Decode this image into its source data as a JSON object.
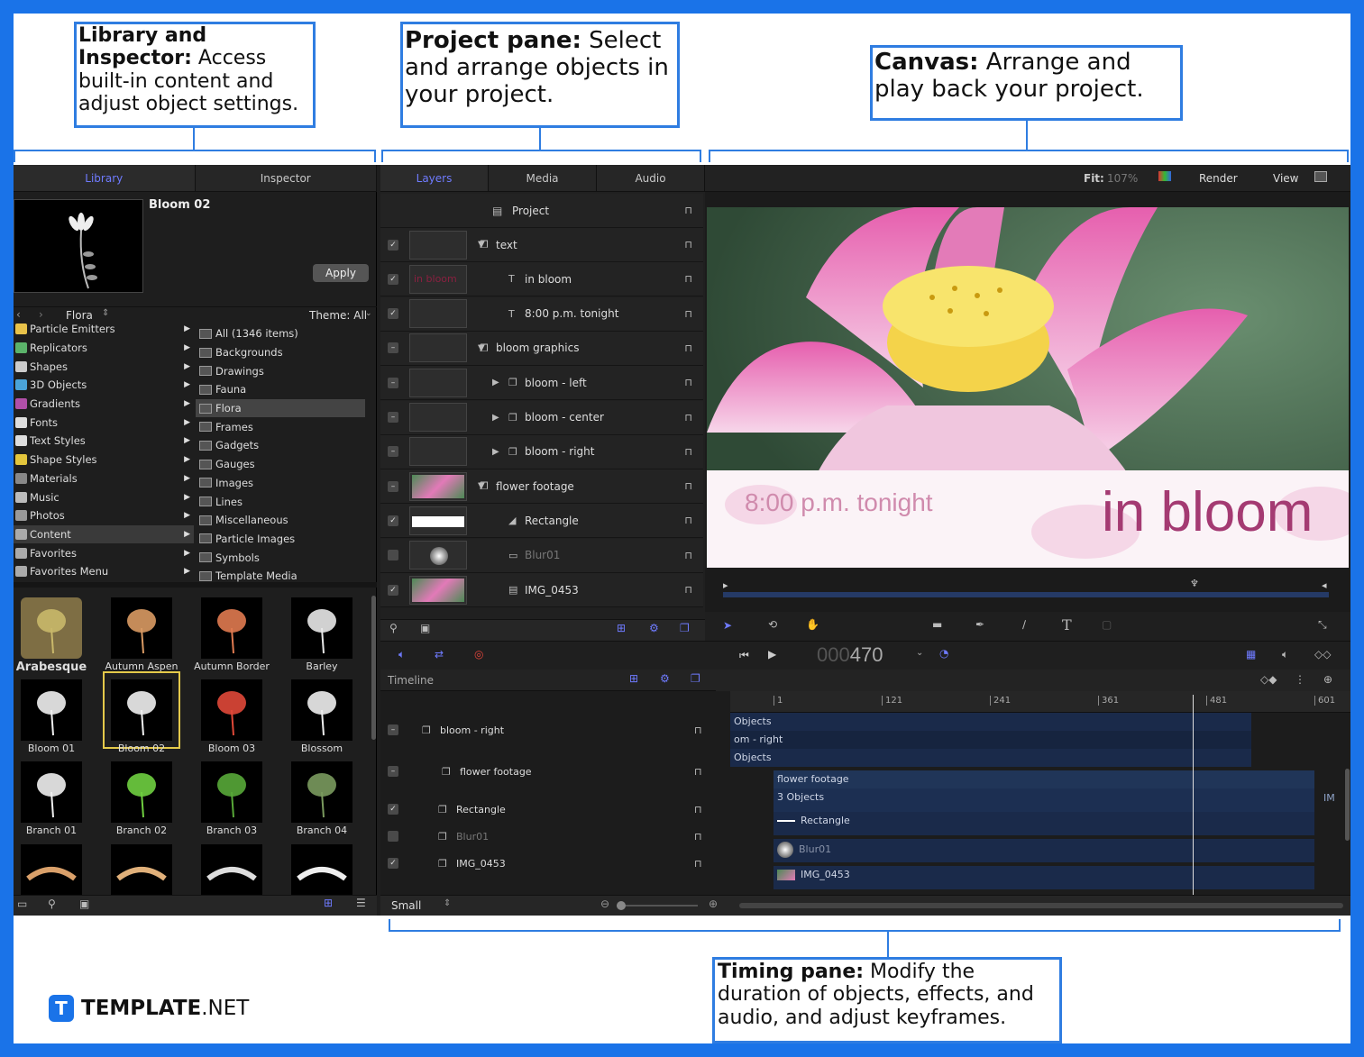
{
  "callouts": {
    "library": {
      "bold": "Library and Inspector:",
      "text": " Access built-in content and adjust object settings."
    },
    "project": {
      "bold": "Project pane:",
      "text": " Select and arrange objects in your project."
    },
    "canvas": {
      "bold": "Canvas:",
      "text": " Arrange and play back your project."
    },
    "timing": {
      "bold": "Timing pane:",
      "text": " Modify the duration of objects, effects, and audio, and adjust keyframes."
    }
  },
  "brand": {
    "logo_letter": "T",
    "name_bold": "TEMPLATE",
    "name_rest": ".NET"
  },
  "library_panel": {
    "tabs": [
      "Library",
      "Inspector"
    ],
    "preview_title": "Bloom 02",
    "apply_label": "Apply",
    "nav_folder": "Flora",
    "theme_label": "Theme: All",
    "categories": [
      {
        "label": "Particle Emitters",
        "color": "#e8c24a"
      },
      {
        "label": "Replicators",
        "color": "#5bb36a"
      },
      {
        "label": "Shapes",
        "color": "#cccccc"
      },
      {
        "label": "3D Objects",
        "color": "#4aa3d8"
      },
      {
        "label": "Gradients",
        "color": "#b04fa8"
      },
      {
        "label": "Fonts",
        "color": "#dddddd"
      },
      {
        "label": "Text Styles",
        "color": "#dddddd"
      },
      {
        "label": "Shape Styles",
        "color": "#e3c53c"
      },
      {
        "label": "Materials",
        "color": "#888888"
      },
      {
        "label": "Music",
        "color": "#bbbbbb"
      },
      {
        "label": "Photos",
        "color": "#999999"
      },
      {
        "label": "Content",
        "color": "#aaaaaa"
      },
      {
        "label": "Favorites",
        "color": "#aaaaaa"
      },
      {
        "label": "Favorites Menu",
        "color": "#aaaaaa"
      }
    ],
    "selected_category": "Content",
    "folders": [
      "All (1346 items)",
      "Backgrounds",
      "Drawings",
      "Fauna",
      "Flora",
      "Frames",
      "Gadgets",
      "Gauges",
      "Images",
      "Lines",
      "Miscellaneous",
      "Particle Images",
      "Symbols",
      "Template Media"
    ],
    "selected_folder": "Flora",
    "items": [
      "Arabesque",
      "Autumn Aspen",
      "Autumn Border",
      "Barley",
      "Bloom 01",
      "Bloom 02",
      "Bloom 03",
      "Blossom",
      "Branch 01",
      "Branch 02",
      "Branch 03",
      "Branch 04"
    ],
    "selected_item": "Bloom 02"
  },
  "project_panel": {
    "tabs": [
      "Layers",
      "Media",
      "Audio"
    ],
    "project_label": "Project",
    "layers": [
      {
        "name": "text",
        "checked": true,
        "kind": "group"
      },
      {
        "name": "in bloom",
        "checked": true,
        "kind": "text",
        "thumb_text": "in bloom"
      },
      {
        "name": "8:00 p.m. tonight",
        "checked": true,
        "kind": "text"
      },
      {
        "name": "bloom graphics",
        "checked": "mixed",
        "kind": "group"
      },
      {
        "name": "bloom - left",
        "checked": "mixed",
        "kind": "sub"
      },
      {
        "name": "bloom - center",
        "checked": "mixed",
        "kind": "sub"
      },
      {
        "name": "bloom - right",
        "checked": "mixed",
        "kind": "sub"
      },
      {
        "name": "flower footage",
        "checked": "mixed",
        "kind": "group"
      },
      {
        "name": "Rectangle",
        "checked": true,
        "kind": "shape"
      },
      {
        "name": "Blur01",
        "checked": false,
        "kind": "filter"
      },
      {
        "name": "IMG_0453",
        "checked": true,
        "kind": "image"
      }
    ]
  },
  "canvas": {
    "fit_label": "Fit:",
    "fit_value": "107%",
    "render_label": "Render",
    "view_label": "View",
    "overlay_small": "8:00 p.m. tonight",
    "overlay_big": "in bloom"
  },
  "transport": {
    "timecode_dim": "000",
    "timecode": "470"
  },
  "timeline": {
    "label": "Timeline",
    "ruler": [
      "1",
      "121",
      "241",
      "361",
      "481",
      "601"
    ],
    "layers": [
      {
        "name": "bloom - right",
        "checked": "mixed"
      },
      {
        "name": "flower footage",
        "checked": "mixed"
      },
      {
        "name": "Rectangle",
        "checked": true
      },
      {
        "name": "Blur01",
        "checked": false
      },
      {
        "name": "IMG_0453",
        "checked": true
      }
    ],
    "tracks": [
      "Objects",
      "om - right",
      "Objects",
      "flower footage",
      "3 Objects",
      "Rectangle",
      "Blur01",
      "IMG_0453"
    ],
    "tail_label": "IM",
    "size_label": "Small"
  }
}
